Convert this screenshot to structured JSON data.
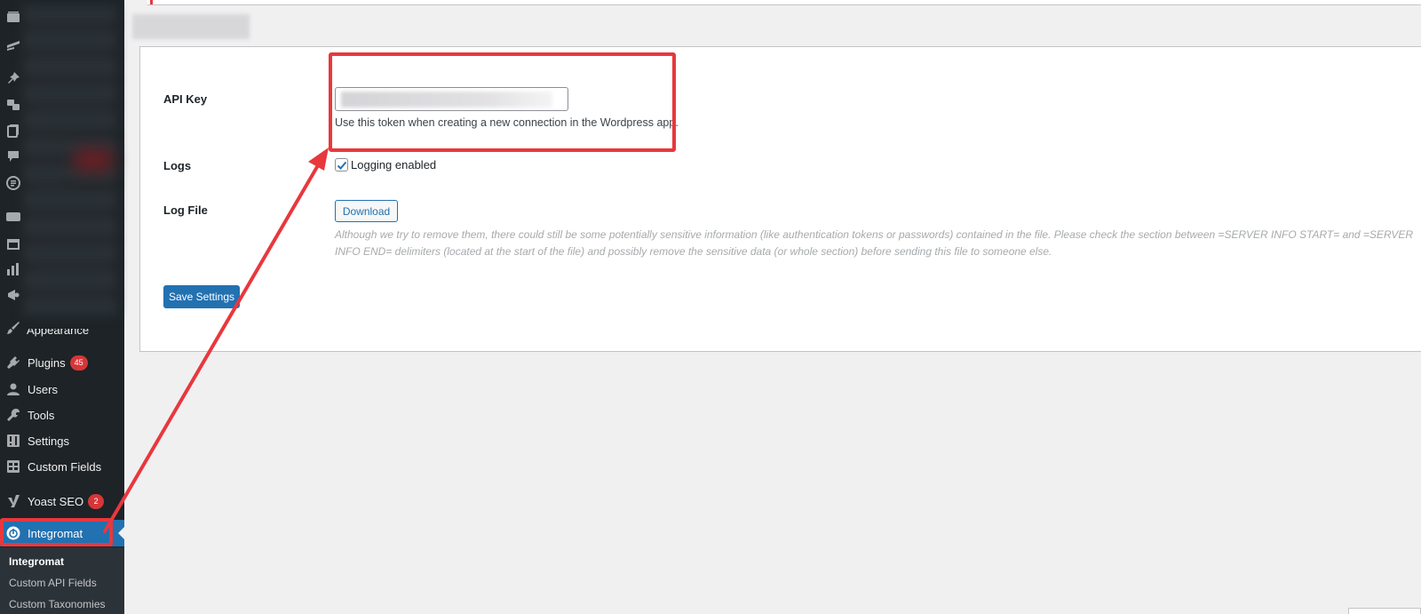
{
  "sidebar": {
    "appearance_label": "Appearance",
    "items": [
      {
        "label": "Plugins",
        "badge": "45",
        "icon": "plugin-icon"
      },
      {
        "label": "Users",
        "icon": "user-icon"
      },
      {
        "label": "Tools",
        "icon": "wrench-icon"
      },
      {
        "label": "Settings",
        "icon": "settings-icon"
      },
      {
        "label": "Custom Fields",
        "icon": "table-icon"
      },
      {
        "label": "Yoast SEO",
        "badge": "2",
        "icon": "yoast-icon"
      },
      {
        "label": "Integromat",
        "icon": "power-icon",
        "active": true
      }
    ],
    "submenu": [
      "Integromat",
      "Custom API Fields",
      "Custom Taxonomies"
    ]
  },
  "settings": {
    "api_key_label": "API Key",
    "api_key_helper": "Use this token when creating a new connection in the Wordpress app.",
    "logs_label": "Logs",
    "logging_checkbox_label": "Logging enabled",
    "logging_enabled": true,
    "log_file_label": "Log File",
    "download_label": "Download",
    "log_file_description": "Although we try to remove them, there could still be some potentially sensitive information (like authentication tokens or passwords) contained in the file. Please check the section between =SERVER INFO START= and =SERVER INFO END= delimiters (located at the start of the file) and possibly remove the sensitive data (or whole section) before sending this file to someone else.",
    "save_label": "Save Settings"
  },
  "colors": {
    "sidebar_bg": "#1d2327",
    "accent": "#2271b1",
    "badge": "#d63638",
    "annotation": "#e8383d"
  }
}
